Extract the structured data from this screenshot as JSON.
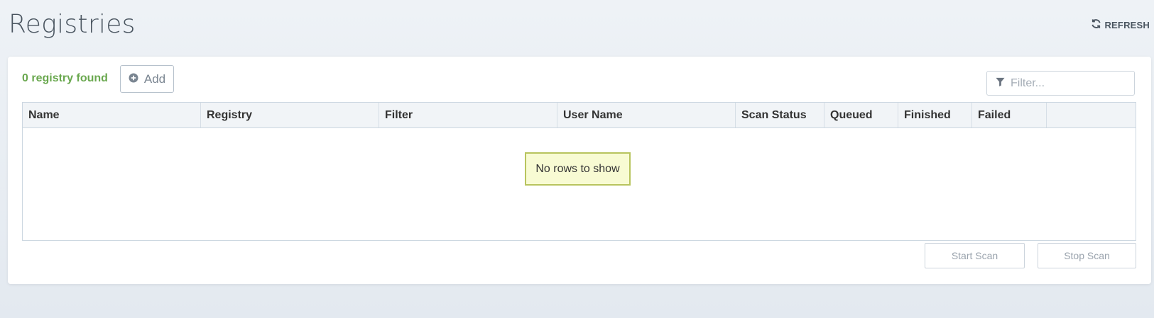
{
  "page": {
    "title": "Registries"
  },
  "toolbar": {
    "refresh_label": "REFRESH",
    "refresh_icon": "refresh-icon"
  },
  "registries": {
    "count_label": "0 registry found",
    "add_label": "Add",
    "add_icon": "plus-circle-icon",
    "filter_placeholder": "Filter...",
    "filter_icon": "filter-icon",
    "columns": [
      "Name",
      "Registry",
      "Filter",
      "User Name",
      "Scan Status",
      "Queued",
      "Finished",
      "Failed",
      ""
    ],
    "rows": [],
    "empty_message": "No rows to show",
    "start_scan_label": "Start Scan",
    "stop_scan_label": "Stop Scan"
  },
  "colors": {
    "count_text": "#6aa84f",
    "empty_overlay_bg": "#f8fbd3",
    "empty_overlay_border": "#b8c45e",
    "header_bg": "#f1f4f7"
  }
}
